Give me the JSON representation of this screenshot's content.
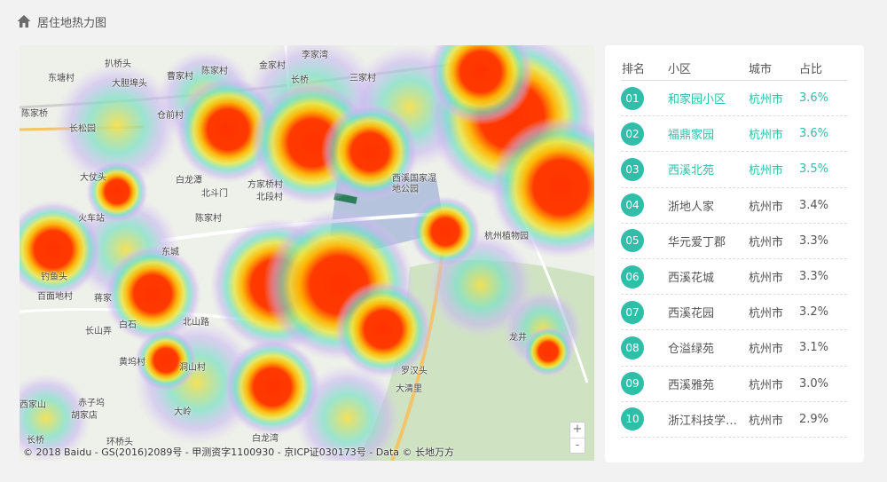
{
  "page": {
    "title": "居住地热力图",
    "icon": "home-icon"
  },
  "map": {
    "copyright": "© 2018 Baidu - GS(2016)2089号 - 甲测资字1100930 - 京ICP证030173号 - Data © 长地万方",
    "zoom_in": "+",
    "zoom_out": "-",
    "places": [
      "扒桥头",
      "金家村",
      "李家湾",
      "东塘村",
      "大胆埠头",
      "曹家村",
      "陈家村",
      "长桥",
      "三家村",
      "陈家桥",
      "长松园",
      "仓前村",
      "白龙潭",
      "方家桥村",
      "北段村",
      "西溪国家湿地公园",
      "大仗头",
      "北斗门",
      "陈家村",
      "火车站",
      "东城",
      "杭州植物园",
      "钓鱼头",
      "百面地村",
      "蒋家",
      "北山路",
      "长山弄",
      "白石",
      "龙井",
      "黄坞村",
      "洞山村",
      "大岭",
      "罗汉头",
      "大清里",
      "西家山",
      "赤子坞",
      "胡家店",
      "长桥",
      "环桥头",
      "白龙湾"
    ]
  },
  "ranking": {
    "headers": {
      "rank": "排名",
      "name": "小区",
      "city": "城市",
      "ratio": "占比"
    },
    "rows": [
      {
        "rank": "01",
        "name": "和家园小区",
        "city": "杭州市",
        "ratio": "3.6%"
      },
      {
        "rank": "02",
        "name": "福鼎家园",
        "city": "杭州市",
        "ratio": "3.6%"
      },
      {
        "rank": "03",
        "name": "西溪北苑",
        "city": "杭州市",
        "ratio": "3.5%"
      },
      {
        "rank": "04",
        "name": "浙地人家",
        "city": "杭州市",
        "ratio": "3.4%"
      },
      {
        "rank": "05",
        "name": "华元爱丁郡",
        "city": "杭州市",
        "ratio": "3.3%"
      },
      {
        "rank": "06",
        "name": "西溪花城",
        "city": "杭州市",
        "ratio": "3.3%"
      },
      {
        "rank": "07",
        "name": "西溪花园",
        "city": "杭州市",
        "ratio": "3.2%"
      },
      {
        "rank": "08",
        "name": "仓溢绿苑",
        "city": "杭州市",
        "ratio": "3.1%"
      },
      {
        "rank": "09",
        "name": "西溪雅苑",
        "city": "杭州市",
        "ratio": "3.0%"
      },
      {
        "rank": "10",
        "name": "浙江科技学院...",
        "city": "杭州市",
        "ratio": "2.9%"
      }
    ]
  },
  "colors": {
    "accent": "#2fbfa8",
    "heat_high": "#ff3300",
    "heat_mid": "#ffcc00",
    "heat_low": "#66ddcc"
  }
}
